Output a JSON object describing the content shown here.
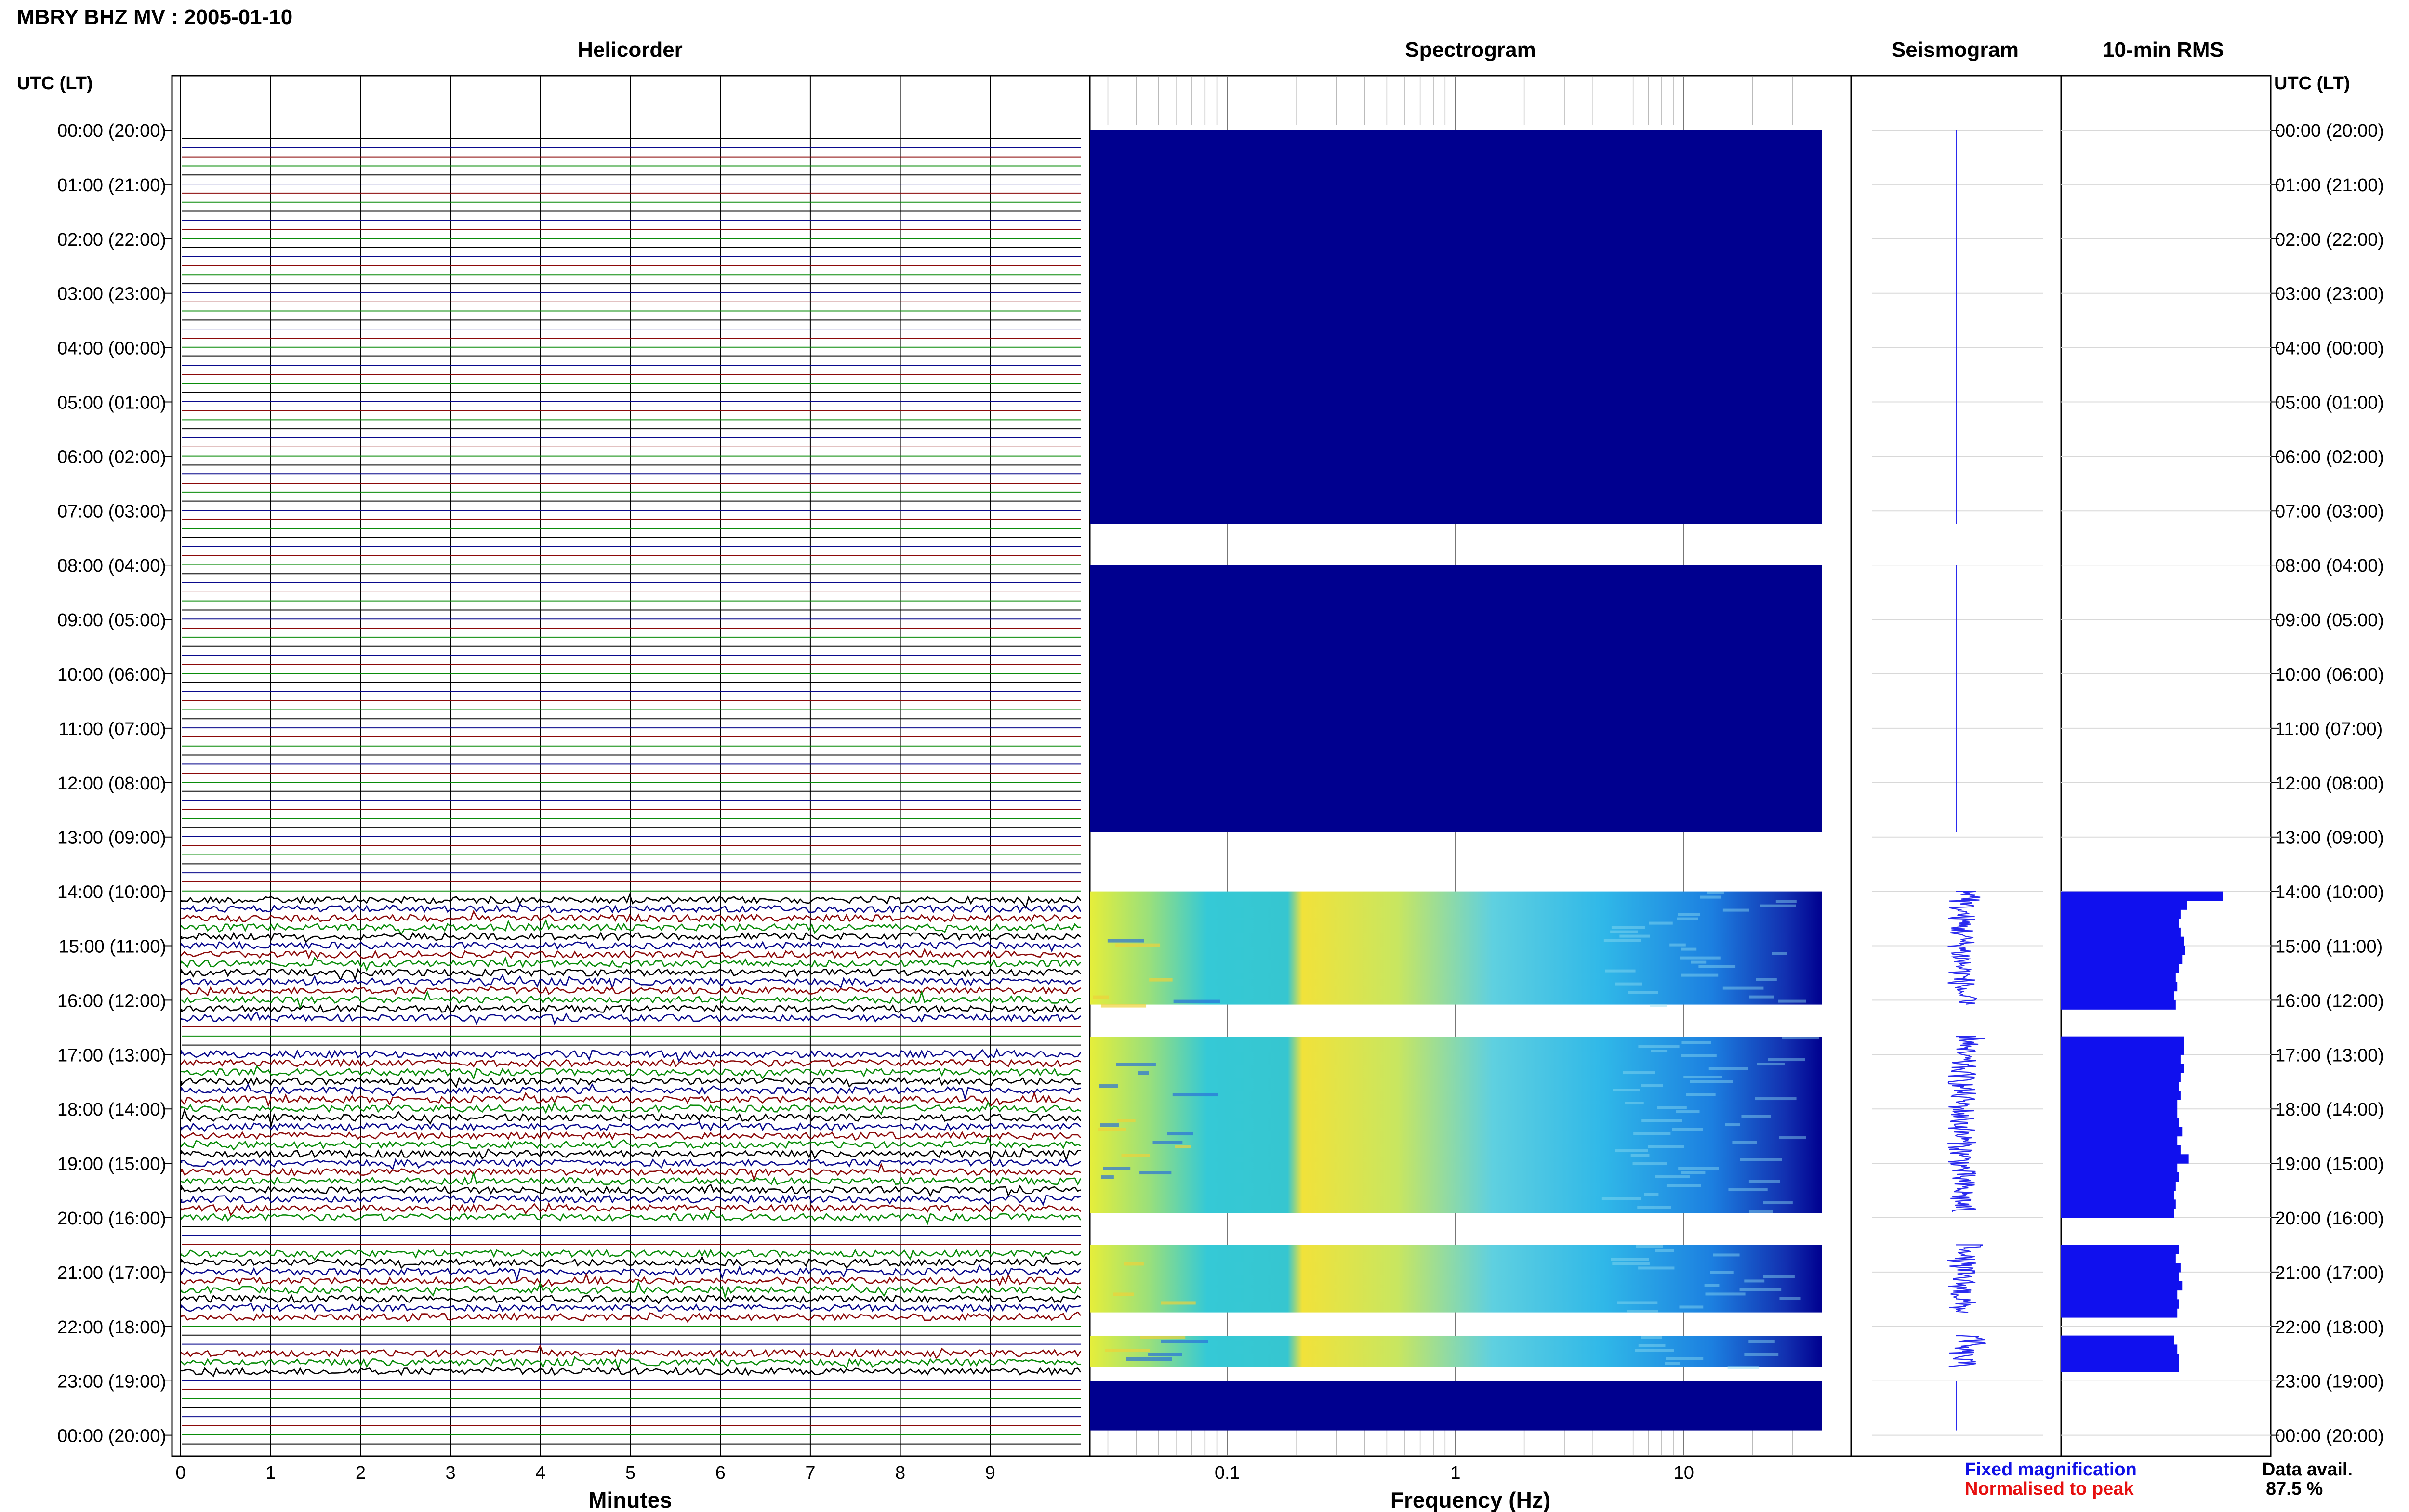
{
  "header": {
    "title": "MBRY BHZ MV : 2005-01-10",
    "utc_label_left": "UTC (LT)",
    "utc_label_right": "UTC (LT)"
  },
  "panels": {
    "helicorder": "Helicorder",
    "spectrogram": "Spectrogram",
    "seismogram": "Seismogram",
    "rms": "10-min RMS"
  },
  "hour_labels": [
    "00:00 (20:00)",
    "01:00 (21:00)",
    "02:00 (22:00)",
    "03:00 (23:00)",
    "04:00 (00:00)",
    "05:00 (01:00)",
    "06:00 (02:00)",
    "07:00 (03:00)",
    "08:00 (04:00)",
    "09:00 (05:00)",
    "10:00 (06:00)",
    "11:00 (07:00)",
    "12:00 (08:00)",
    "13:00 (09:00)",
    "14:00 (10:00)",
    "15:00 (11:00)",
    "16:00 (12:00)",
    "17:00 (13:00)",
    "18:00 (14:00)",
    "19:00 (15:00)",
    "20:00 (16:00)",
    "21:00 (17:00)",
    "22:00 (18:00)",
    "23:00 (19:00)",
    "00:00 (20:00)"
  ],
  "helicorder_axis": {
    "ticks": [
      "0",
      "1",
      "2",
      "3",
      "4",
      "5",
      "6",
      "7",
      "8",
      "9"
    ],
    "xlabel": "Minutes"
  },
  "spectrogram_axis": {
    "ticks": [
      "0.1",
      "1",
      "10"
    ],
    "xlabel": "Frequency (Hz)"
  },
  "legend": {
    "fixed": "Fixed magnification",
    "normalised": "Normalised to peak",
    "fixed_color": "#1010e6",
    "normalised_color": "#e61010"
  },
  "data_avail": {
    "label": "Data avail.",
    "value": "87.5 %"
  },
  "colors": {
    "trace_cycle": [
      "#000000",
      "#0a0a8c",
      "#8c0a0a",
      "#0a8c0a"
    ],
    "spectrogram_fill": "#00008f",
    "rms_bar": "#1010ee",
    "seis_trace": "#2a2aee"
  },
  "chart_data": [
    {
      "type": "line",
      "title": "Helicorder",
      "xlabel": "Minutes",
      "xlim": [
        0,
        10
      ],
      "rows_per_hour": 6,
      "row_minutes": 10,
      "active_rows": [
        [
          14.0,
          16.17
        ],
        [
          16.67,
          20.0
        ],
        [
          20.5,
          21.83
        ],
        [
          22.17,
          22.83
        ]
      ],
      "note_values": "quiet traces outside active intervals; active traces show continuous noise"
    },
    {
      "type": "heatmap",
      "title": "Spectrogram",
      "xlabel": "Frequency (Hz)",
      "x_scale": "log",
      "xlim": [
        0.025,
        40
      ],
      "segments_low_level": [
        [
          0.0,
          7.33
        ],
        [
          8.0,
          13.0
        ],
        [
          23.0,
          24.0
        ]
      ],
      "segments_active": [
        [
          14.0,
          16.17
        ],
        [
          16.67,
          20.0
        ],
        [
          20.5,
          21.83
        ],
        [
          22.17,
          22.83
        ]
      ]
    },
    {
      "type": "line",
      "title": "Seismogram",
      "segments_active": [
        [
          14.0,
          16.17
        ],
        [
          16.67,
          20.0
        ],
        [
          20.5,
          21.83
        ],
        [
          22.17,
          22.83
        ]
      ]
    },
    {
      "type": "bar",
      "title": "10-min RMS",
      "rows_start_hour": 14.0,
      "row_minutes": 10,
      "values": [
        1.0,
        0.78,
        0.74,
        0.73,
        0.74,
        0.76,
        0.77,
        0.75,
        0.73,
        0.71,
        0.72,
        0.7,
        0.71,
        null,
        null,
        null,
        0.76,
        0.76,
        0.74,
        0.76,
        0.74,
        0.73,
        0.74,
        0.72,
        0.72,
        0.73,
        0.75,
        0.72,
        0.74,
        0.79,
        0.72,
        0.73,
        0.71,
        0.7,
        0.71,
        0.7,
        null,
        null,
        null,
        0.73,
        0.71,
        0.74,
        0.73,
        0.75,
        0.72,
        0.73,
        0.72,
        null,
        null,
        0.7,
        0.72,
        0.73,
        0.73
      ]
    }
  ]
}
